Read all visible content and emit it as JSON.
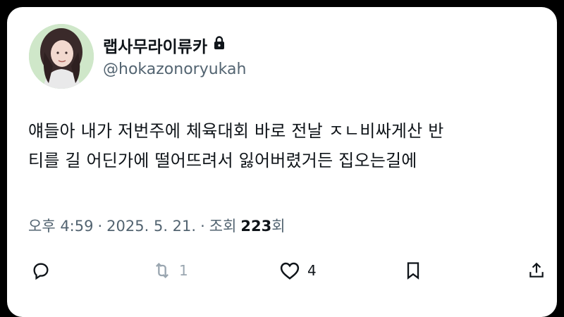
{
  "user": {
    "display_name": "랩사무라이류카",
    "handle": "@hokazonoryukah",
    "locked_icon": "lock-icon"
  },
  "tweet": {
    "text_line1": "얘들아 내가 저번주에 체육대회 바로 전날 ㅈㄴ비싸게산 반",
    "text_line2": "티를 길 어딘가에 떨어뜨려서 잃어버렸거든 집오는길에"
  },
  "meta": {
    "time": "오후 4:59",
    "sep1": "·",
    "date": "2025. 5. 21.",
    "sep2": "·",
    "views_label": "조회",
    "views_count": "223",
    "views_suffix": "회"
  },
  "actions": {
    "reply_icon": "reply-icon",
    "retweet_icon": "retweet-icon",
    "retweet_count": "1",
    "like_icon": "heart-icon",
    "like_count": "4",
    "bookmark_icon": "bookmark-icon",
    "share_icon": "share-icon"
  },
  "colors": {
    "text": "#0f1419",
    "secondary": "#536471"
  }
}
